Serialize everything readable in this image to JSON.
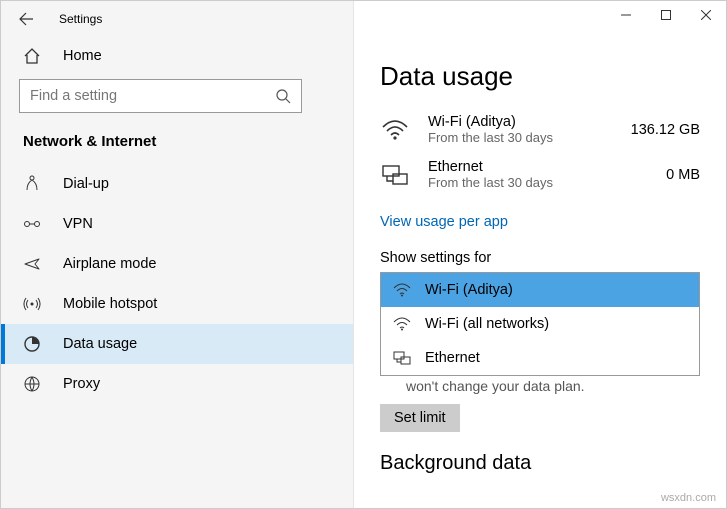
{
  "window": {
    "title": "Settings"
  },
  "home": {
    "label": "Home"
  },
  "search": {
    "placeholder": "Find a setting"
  },
  "section": {
    "title": "Network & Internet"
  },
  "nav": {
    "items": [
      {
        "label": "Dial-up"
      },
      {
        "label": "VPN"
      },
      {
        "label": "Airplane mode"
      },
      {
        "label": "Mobile hotspot"
      },
      {
        "label": "Data usage"
      },
      {
        "label": "Proxy"
      }
    ]
  },
  "page": {
    "title": "Data usage",
    "usage": [
      {
        "name": "Wi-Fi (Aditya)",
        "sub": "From the last 30 days",
        "value": "136.12 GB"
      },
      {
        "name": "Ethernet",
        "sub": "From the last 30 days",
        "value": "0 MB"
      }
    ],
    "link": "View usage per app",
    "dropdown_label": "Show settings for",
    "dropdown": [
      {
        "label": "Wi-Fi (Aditya)"
      },
      {
        "label": "Wi-Fi (all networks)"
      },
      {
        "label": "Ethernet"
      }
    ],
    "hint": "won't change your data plan.",
    "set_limit": "Set limit",
    "section2": "Background data"
  },
  "watermark": "wsxdn.com"
}
